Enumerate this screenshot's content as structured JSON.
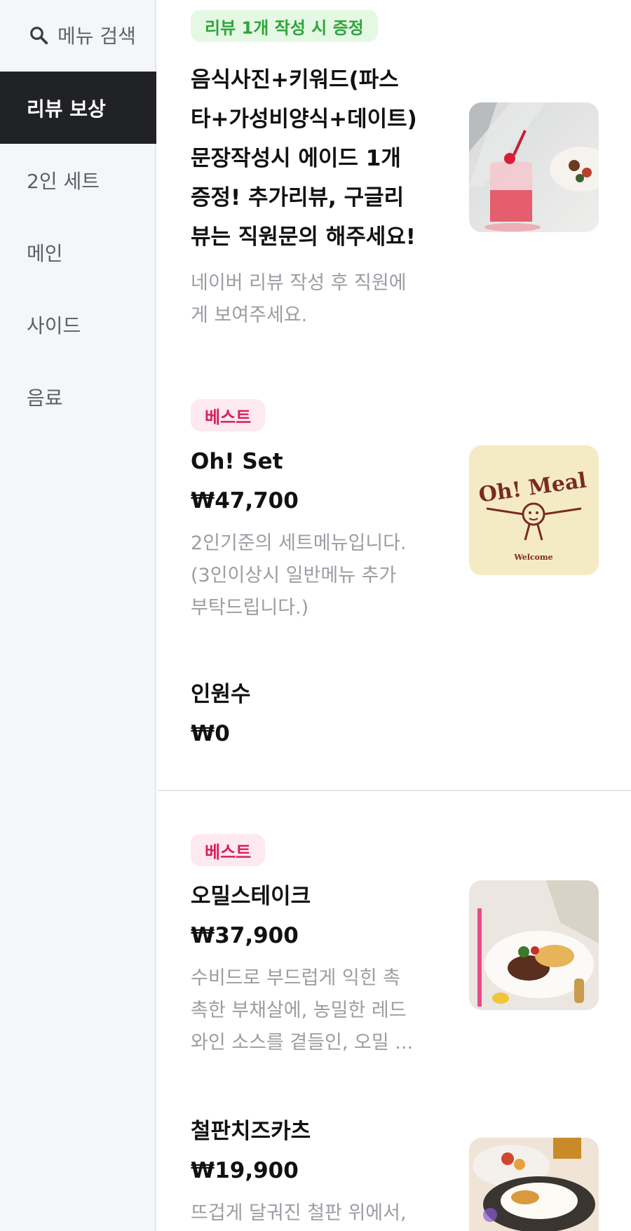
{
  "sidebar": {
    "search_label": "메뉴 검색",
    "categories": [
      "리뷰 보상",
      "2인 세트",
      "메인",
      "사이드",
      "음료"
    ]
  },
  "menu": {
    "review": {
      "badge": "리뷰 1개 작성 시 증정",
      "title_lines": [
        "음식사진+키워드(파스",
        "타+가성비양식+데이트)",
        "문장작성시 에이드 1개",
        "증정! 추가리뷰, 구글리",
        "뷰는 직원문의 해주세요!"
      ],
      "desc_lines": [
        "네이버 리뷰 작성 후 직원에",
        "게 보여주세요."
      ]
    },
    "oh_set": {
      "badge": "베스트",
      "name": "Oh! Set",
      "price": "₩47,700",
      "desc_lines": [
        "2인기준의 세트메뉴입니다.",
        "(3인이상시 일반메뉴 추가",
        "부탁드립니다.)"
      ],
      "option_name": "인원수",
      "option_price": "₩0",
      "logo_text": "Oh! Meal",
      "logo_sub": "Welcome"
    },
    "steak": {
      "badge": "베스트",
      "name": "오밀스테이크",
      "price": "₩37,900",
      "desc_lines": [
        "수비드로 부드럽게 익힌 촉",
        "촉한 부채살에, 농밀한 레드",
        "와인 소스를 곁들인, 오밀 ..."
      ]
    },
    "katsu": {
      "name": "철판치즈카츠",
      "price": "₩19,900",
      "desc_lines": [
        "뜨겁게 달궈진 철판 위에서,"
      ]
    }
  },
  "colors": {
    "sidebar_bg": "#f4f6f9",
    "active_bg": "#212225",
    "green_badge": "#2fa53a",
    "pink_badge": "#d6205a",
    "muted_text": "#9a9ea3"
  }
}
